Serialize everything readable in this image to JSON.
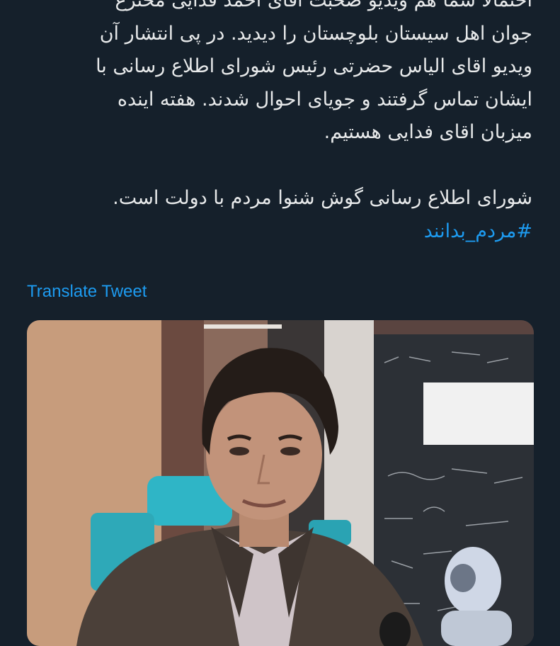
{
  "tweet": {
    "lines": [
      "احتمالا شما هم ویدیو صحبت آقای احمد فدایی مخترع",
      "جوان اهل سیستان بلوچستان را دیدید. در پی انتشار آن",
      "ویدیو اقای الیاس حضرتی رئیس شورای اطلاع رسانی با",
      "ایشان تماس گرفتند و جویای احوال شدند. هفته اینده",
      "میزبان اقای فدایی هستیم."
    ],
    "closing": "شورای اطلاع رسانی گوش شنوا مردم با دولت است.",
    "hashtag": "#مردم_بدانند"
  },
  "translate_label": "Translate Tweet",
  "media": {
    "icon": "video-thumbnail",
    "colors": {
      "accent": "#1d9bf0",
      "background": "#15202b",
      "text": "#e7e9ea"
    }
  }
}
